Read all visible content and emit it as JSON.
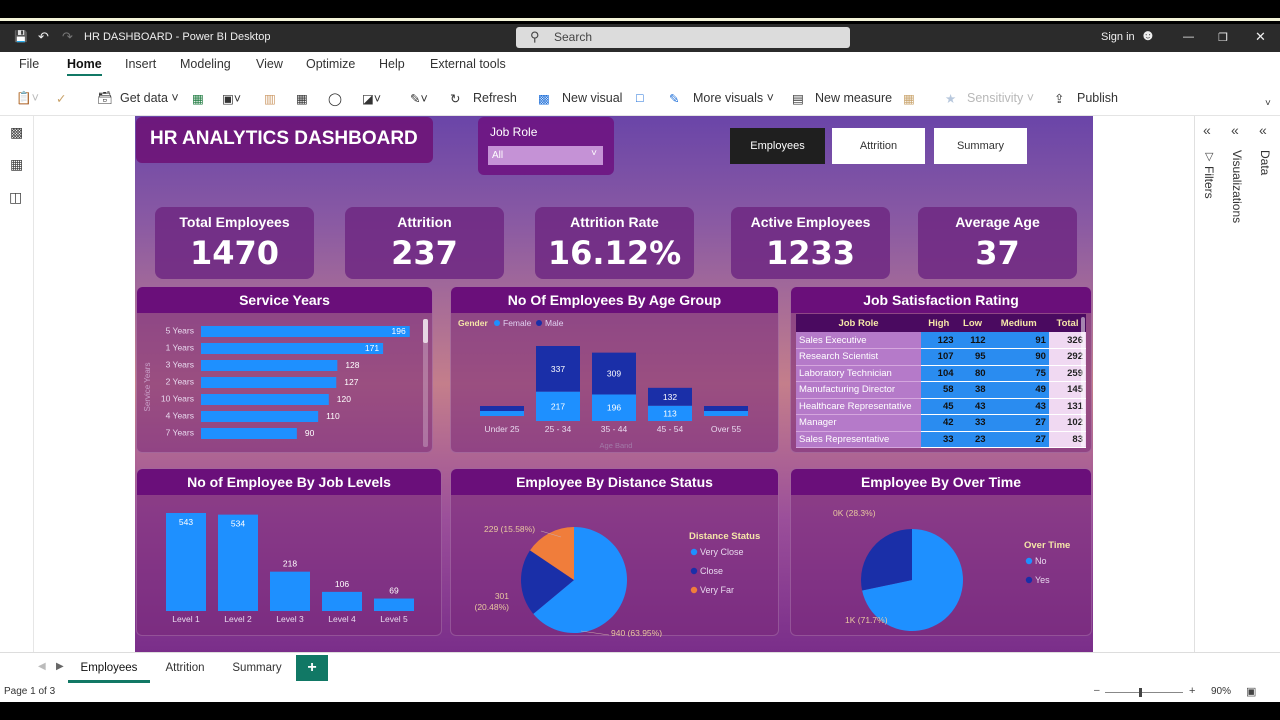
{
  "titlebar": {
    "title": "HR DASHBOARD - Power BI Desktop",
    "search_placeholder": "Search",
    "sign_in": "Sign in"
  },
  "menu": [
    "File",
    "Home",
    "Insert",
    "Modeling",
    "View",
    "Optimize",
    "Help",
    "External tools"
  ],
  "ribbon": {
    "get_data": "Get data",
    "refresh": "Refresh",
    "new_visual": "New visual",
    "more_visuals": "More visuals",
    "new_measure": "New measure",
    "sensitivity": "Sensitivity",
    "publish": "Publish"
  },
  "rightpane": {
    "filters": "Filters",
    "visualizations": "Visualizations",
    "data": "Data"
  },
  "dashboard": {
    "title": "HR ANALYTICS DASHBOARD",
    "slicer": {
      "label": "Job Role",
      "value": "All"
    },
    "nav": [
      "Employees",
      "Attrition",
      "Summary"
    ],
    "kpis": [
      {
        "label": "Total Employees",
        "value": "1470"
      },
      {
        "label": "Attrition",
        "value": "237"
      },
      {
        "label": "Attrition Rate",
        "value": "16.12%"
      },
      {
        "label": "Active Employees",
        "value": "1233"
      },
      {
        "label": "Average Age",
        "value": "37"
      }
    ],
    "service_title": "Service Years",
    "service_axis": "Service Years",
    "age_title": "No Of Employees By Age Group",
    "age_legend": {
      "label": "Gender",
      "female": "Female",
      "male": "Male"
    },
    "age_axis": "Age Band",
    "jobsat_title": "Job Satisfaction Rating",
    "joblevel_title": "No of Employee By Job Levels",
    "distance_title": "Employee By Distance Status",
    "distance_legend_title": "Distance Status",
    "overtime_title": "Employee By Over Time",
    "overtime_legend_title": "Over Time"
  },
  "jobsat": {
    "headers": [
      "Job Role",
      "High",
      "Low",
      "Medium",
      "Total"
    ],
    "rows": [
      [
        "Sales Executive",
        "123",
        "112",
        "91",
        "326"
      ],
      [
        "Research Scientist",
        "107",
        "95",
        "90",
        "292"
      ],
      [
        "Laboratory Technician",
        "104",
        "80",
        "75",
        "259"
      ],
      [
        "Manufacturing Director",
        "58",
        "38",
        "49",
        "145"
      ],
      [
        "Healthcare Representative",
        "45",
        "43",
        "43",
        "131"
      ],
      [
        "Manager",
        "42",
        "33",
        "27",
        "102"
      ],
      [
        "Sales Representative",
        "33",
        "23",
        "27",
        "83"
      ]
    ]
  },
  "chart_data": [
    {
      "type": "bar",
      "title": "Service Years",
      "categories": [
        "5 Years",
        "1 Years",
        "3 Years",
        "2 Years",
        "10 Years",
        "4 Years",
        "7 Years"
      ],
      "values": [
        196,
        171,
        128,
        127,
        120,
        110,
        90
      ]
    },
    {
      "type": "bar",
      "title": "No Of Employees By Age Group",
      "categories": [
        "Under 25",
        "25 - 34",
        "35 - 44",
        "45 - 54",
        "Over 55"
      ],
      "series": [
        {
          "name": "Female",
          "values": [
            null,
            217,
            196,
            113,
            null
          ]
        },
        {
          "name": "Male",
          "values": [
            null,
            337,
            309,
            132,
            null
          ]
        }
      ]
    },
    {
      "type": "bar",
      "title": "No of Employee By Job Levels",
      "categories": [
        "Level 1",
        "Level 2",
        "Level 3",
        "Level 4",
        "Level 5"
      ],
      "values": [
        543,
        534,
        218,
        106,
        69
      ]
    },
    {
      "type": "pie",
      "title": "Employee By Distance Status",
      "categories": [
        "Very Close",
        "Close",
        "Very Far"
      ],
      "values": [
        940,
        301,
        229
      ],
      "labels": [
        "940 (63.95%)",
        "301 (20.48%)",
        "229 (15.58%)"
      ]
    },
    {
      "type": "pie",
      "title": "Employee By Over Time",
      "categories": [
        "No",
        "Yes"
      ],
      "values": [
        1054,
        416
      ],
      "labels": [
        "1K (71.7%)",
        "0K (28.3%)"
      ]
    }
  ],
  "colors": {
    "female": "#1e90ff",
    "male": "#1a2fa8",
    "very_far": "#f07d3b",
    "accent": "#6a0f7a"
  },
  "tabs": [
    "Employees",
    "Attrition",
    "Summary"
  ],
  "status": {
    "page": "Page 1 of 3",
    "zoom": "90%"
  }
}
